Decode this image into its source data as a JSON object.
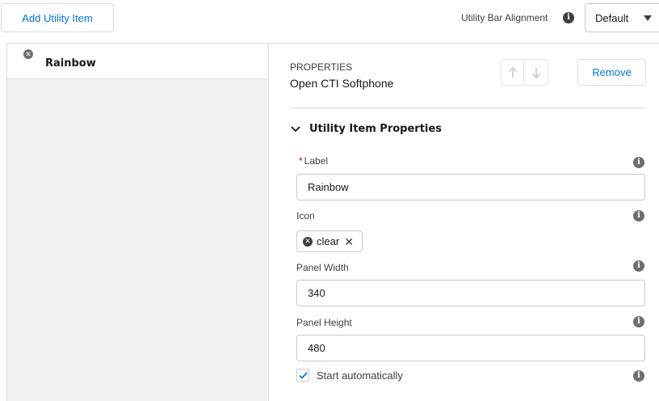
{
  "header": {
    "add_button_label": "Add Utility Item",
    "alignment_label": "Utility Bar Alignment",
    "alignment_value": "Default"
  },
  "sidebar": {
    "items": [
      {
        "label": "Rainbow"
      }
    ]
  },
  "properties": {
    "heading": "PROPERTIES",
    "subheading": "Open CTI Softphone",
    "remove_label": "Remove",
    "section_title": "Utility Item Properties",
    "label_field": {
      "label": "Label",
      "required_mark": "*",
      "value": "Rainbow"
    },
    "icon_field": {
      "label": "Icon",
      "pill_text": "clear"
    },
    "panel_width_field": {
      "label": "Panel Width",
      "value": "340"
    },
    "panel_height_field": {
      "label": "Panel Height",
      "value": "480"
    },
    "start_auto": {
      "label": "Start automatically",
      "checked": true
    }
  },
  "colors": {
    "brand_blue": "#0176d3",
    "required_red": "#ba0517",
    "border": "#dddbda"
  }
}
